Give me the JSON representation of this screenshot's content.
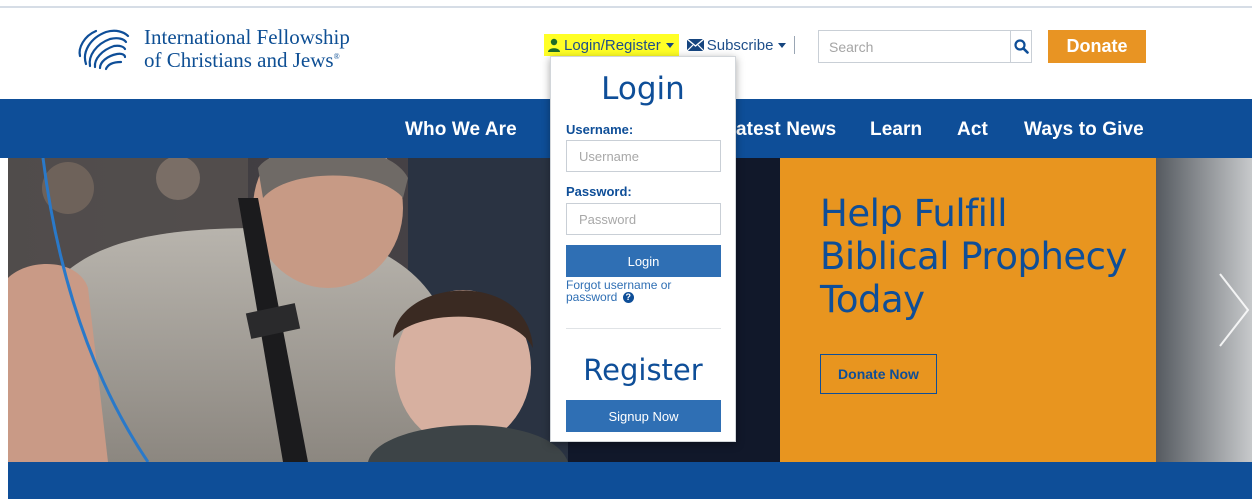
{
  "brand": {
    "name_line1": "International Fellowship",
    "name_line2": "of Christians and Jews",
    "registered": "®",
    "color": "#0e4e98"
  },
  "utility": {
    "login_register": "Login/Register",
    "subscribe": "Subscribe",
    "login_highlight_color": "#ffff26"
  },
  "search": {
    "placeholder": "Search",
    "icon": "search-icon"
  },
  "donate": {
    "label": "Donate",
    "color": "#e89423"
  },
  "nav": {
    "items": [
      "Who We Are",
      "Latest News",
      "Learn",
      "Act",
      "Ways to Give"
    ],
    "visible_partial": "atest News"
  },
  "hero": {
    "headline": "Help Fulfill Biblical Prophecy Today",
    "cta": "Donate Now",
    "panel_color": "#e8951f"
  },
  "login_panel": {
    "title": "Login",
    "username_label": "Username:",
    "username_placeholder": "Username",
    "password_label": "Password:",
    "password_placeholder": "Password",
    "login_button": "Login",
    "forgot": "Forgot username or password",
    "register_title": "Register",
    "signup_button": "Signup Now"
  }
}
